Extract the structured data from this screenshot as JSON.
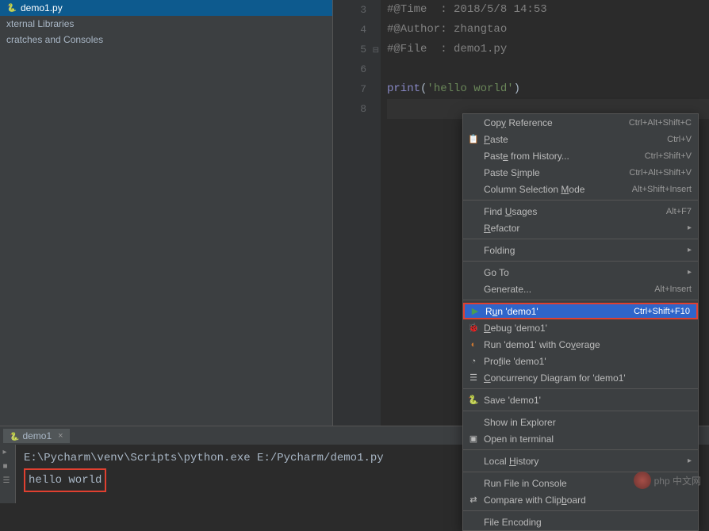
{
  "sidebar": {
    "items": [
      {
        "label": "demo1.py",
        "selected": true,
        "icon": "python-file-icon"
      },
      {
        "label": "xternal Libraries",
        "selected": false
      },
      {
        "label": "cratches and Consoles",
        "selected": false
      }
    ]
  },
  "editor": {
    "lines": [
      {
        "num": "3",
        "comment": "#@Time  : 2018/5/8 14:53"
      },
      {
        "num": "4",
        "comment": "#@Author: zhangtao"
      },
      {
        "num": "5",
        "comment": "#@File  : demo1.py"
      },
      {
        "num": "6",
        "comment": ""
      },
      {
        "num": "7",
        "print_kw": "print",
        "paren_open": "(",
        "str": "'hello world'",
        "paren_close": ")"
      },
      {
        "num": "8",
        "comment": ""
      }
    ]
  },
  "tab": {
    "label": "demo1",
    "icon": "python-file-icon"
  },
  "console": {
    "command": "E:\\Pycharm\\venv\\Scripts\\python.exe E:/Pycharm/demo1.py",
    "output": "hello world"
  },
  "menu": {
    "items": [
      {
        "label_pre": "Cop",
        "mnemonic": "y",
        "label_post": " Reference",
        "shortcut": "Ctrl+Alt+Shift+C"
      },
      {
        "icon": "paste-icon",
        "mnemonic": "P",
        "label_post": "aste",
        "shortcut": "Ctrl+V"
      },
      {
        "label_pre": "Past",
        "mnemonic": "e",
        "label_post": " from History...",
        "shortcut": "Ctrl+Shift+V"
      },
      {
        "label_pre": "Paste S",
        "mnemonic": "i",
        "label_post": "mple",
        "shortcut": "Ctrl+Alt+Shift+V"
      },
      {
        "label_pre": "Column Selection ",
        "mnemonic": "M",
        "label_post": "ode",
        "shortcut": "Alt+Shift+Insert"
      },
      {
        "sep": true
      },
      {
        "label_pre": "Find ",
        "mnemonic": "U",
        "label_post": "sages",
        "shortcut": "Alt+F7"
      },
      {
        "mnemonic": "R",
        "label_post": "efactor",
        "arrow": true
      },
      {
        "sep": true
      },
      {
        "label_pre": "Foldin",
        "mnemonic": "g",
        "arrow": true
      },
      {
        "sep": true
      },
      {
        "label_pre": "Go To",
        "arrow": true
      },
      {
        "label_pre": "Generate...",
        "shortcut": "Alt+Insert"
      },
      {
        "sep": true
      },
      {
        "icon": "run-icon",
        "icon_class": "green-icon",
        "label_pre": "R",
        "mnemonic": "u",
        "label_post": "n 'demo1'",
        "shortcut": "Ctrl+Shift+F10",
        "highlight": true
      },
      {
        "icon": "debug-icon",
        "icon_class": "green-icon",
        "mnemonic": "D",
        "label_post": "ebug 'demo1'"
      },
      {
        "icon": "coverage-icon",
        "icon_class": "orange-icon",
        "label_pre": "Run 'demo1' with Co",
        "mnemonic": "v",
        "label_post": "erage"
      },
      {
        "icon": "profile-icon",
        "label_pre": "Pro",
        "mnemonic": "f",
        "label_post": "ile 'demo1'"
      },
      {
        "icon": "concurrency-icon",
        "mnemonic": "C",
        "label_post": "oncurrency Diagram for 'demo1'"
      },
      {
        "sep": true
      },
      {
        "icon": "python-file-icon",
        "label_pre": "Save 'demo1'"
      },
      {
        "sep": true
      },
      {
        "label_pre": "Show in Explorer"
      },
      {
        "icon": "terminal-icon",
        "label_pre": "Open in terminal"
      },
      {
        "sep": true
      },
      {
        "label_pre": "Local ",
        "mnemonic": "H",
        "label_post": "istory",
        "arrow": true
      },
      {
        "sep": true
      },
      {
        "label_pre": "Run File in Console"
      },
      {
        "icon": "compare-icon",
        "label_pre": "Compare with Clip",
        "mnemonic": "b",
        "label_post": "oard"
      },
      {
        "sep": true
      },
      {
        "label_pre": "File Encoding"
      }
    ]
  },
  "watermark": {
    "text": "中文网",
    "small": "php"
  }
}
